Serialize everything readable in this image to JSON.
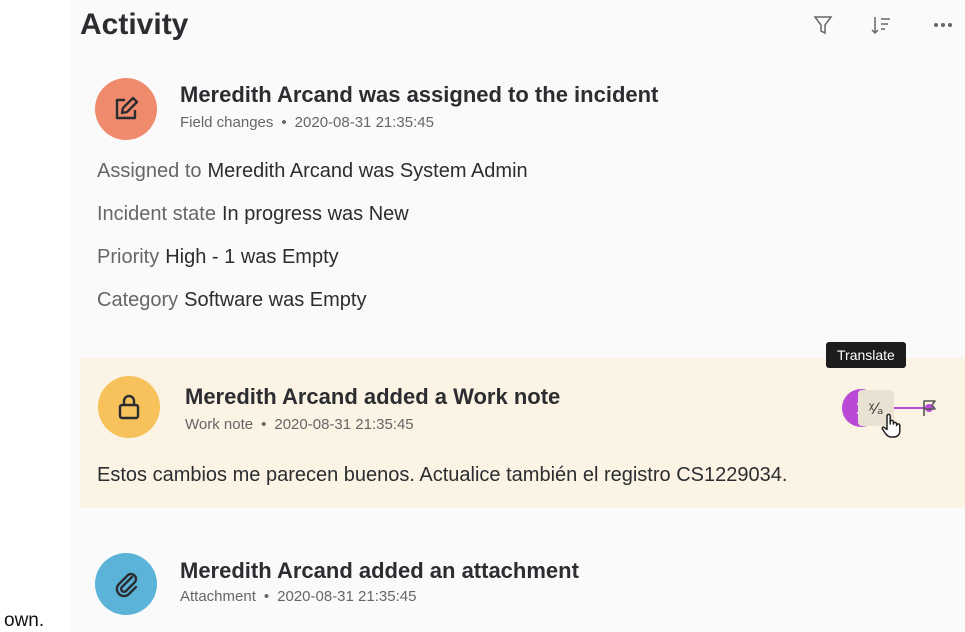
{
  "stray_text": "own.",
  "header": {
    "title": "Activity",
    "icons": [
      "filter-icon",
      "sort-icon",
      "more-icon"
    ]
  },
  "entries": [
    {
      "title": "Meredith Arcand was assigned to the incident",
      "type": "Field changes",
      "timestamp": "2020-08-31 21:35:45",
      "icon": "edit-icon",
      "avatar_color": "#f08a6c",
      "fields": [
        {
          "label": "Assigned to",
          "value": "Meredith Arcand was System Admin"
        },
        {
          "label": "Incident state",
          "value": "In progress was New"
        },
        {
          "label": "Priority",
          "value": "High - 1 was Empty"
        },
        {
          "label": "Category",
          "value": "Software was Empty"
        }
      ]
    },
    {
      "title": "Meredith Arcand added a Work note",
      "type": "Work note",
      "timestamp": "2020-08-31 21:35:45",
      "icon": "lock-icon",
      "avatar_color": "#f7c25b",
      "text": "Estos cambios me parecen buenos. Actualice también el registro CS1229034."
    },
    {
      "title": "Meredith Arcand added an attachment",
      "type": "Attachment",
      "timestamp": "2020-08-31 21:35:45",
      "icon": "paperclip-icon",
      "avatar_color": "#5bb3d8"
    }
  ],
  "tooltip": "Translate",
  "callout_number": "1",
  "translate_glyph": "ᵡ⁄ₐ"
}
